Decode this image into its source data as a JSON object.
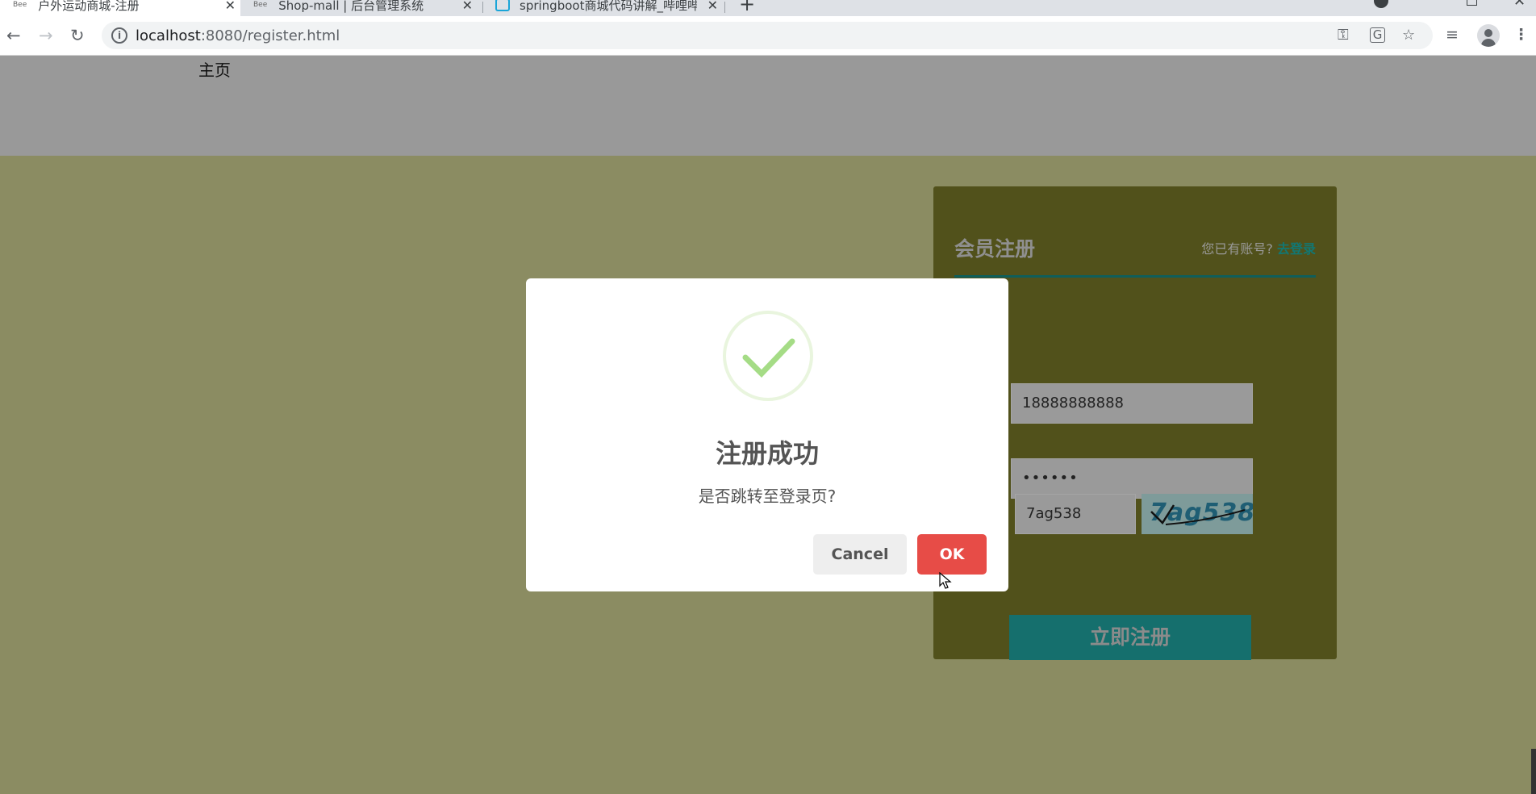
{
  "browser": {
    "tabs": [
      {
        "favicon": "Bee",
        "title": "户外运动商城-注册"
      },
      {
        "favicon": "Bee",
        "title": "Shop-mall | 后台管理系统"
      },
      {
        "favicon": "bilibili-icon",
        "title": "springboot商城代码讲解_哔哩哔"
      }
    ],
    "url_host": "localhost",
    "url_rest": ":8080/register.html"
  },
  "page": {
    "nav_home": "主页",
    "register_form": {
      "title": "会员注册",
      "has_account_text": "您已有账号?",
      "login_link": "去登录",
      "phone_value": "18888888888",
      "password_value": "••••••",
      "captcha_input_value": "7ag538",
      "captcha_image_text": "7ag538",
      "submit_label": "立即注册"
    }
  },
  "dialog": {
    "icon": "success-check-icon",
    "title": "注册成功",
    "text": "是否跳转至登录页?",
    "cancel_label": "Cancel",
    "ok_label": "OK"
  },
  "colors": {
    "page_bg": "#8b8c62",
    "header_bg": "#999999",
    "card_bg": "#51511b",
    "accent_teal": "#156f6d",
    "ok_red": "#e74c47",
    "success_green": "#a5dc86"
  }
}
